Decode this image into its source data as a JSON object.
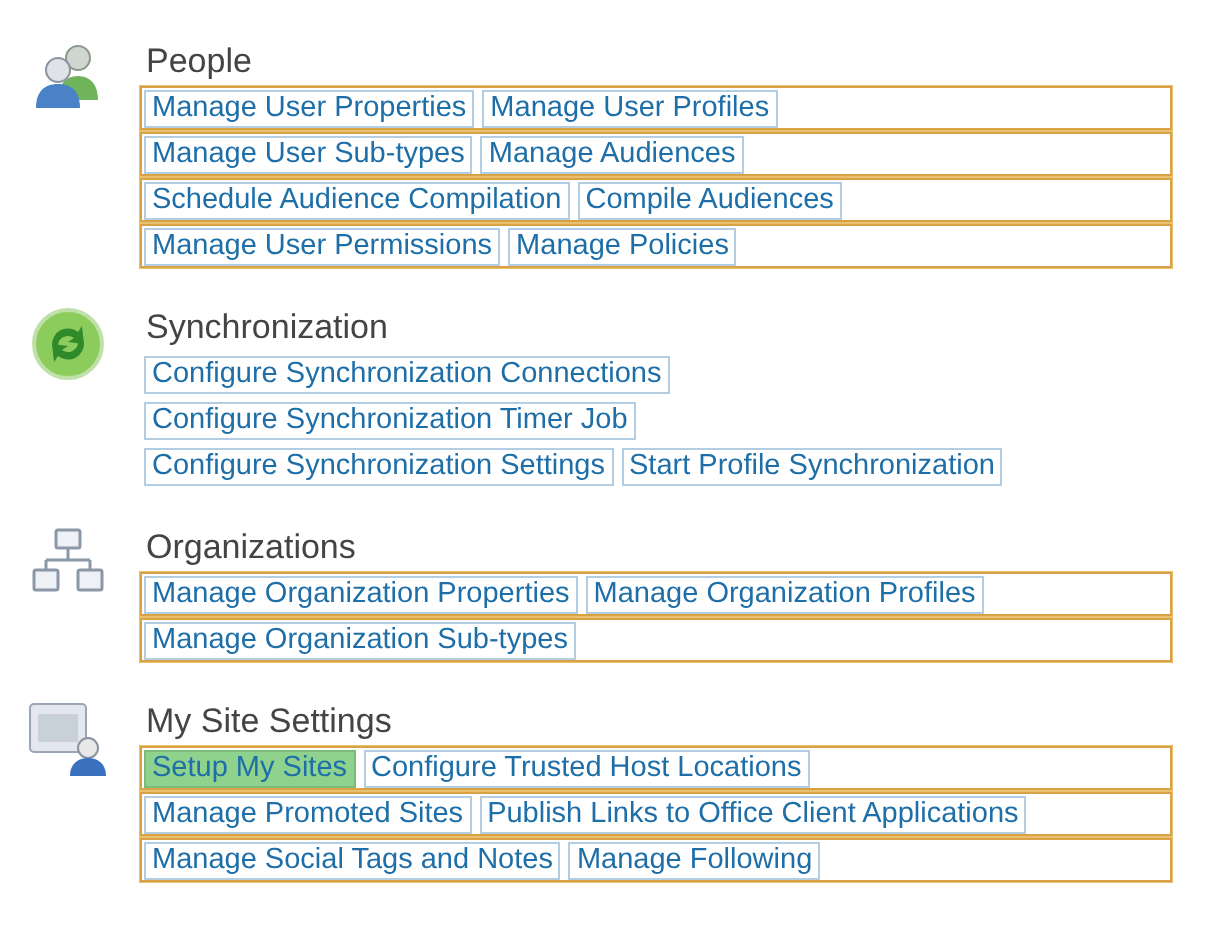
{
  "sections": [
    {
      "kind": "people",
      "title": "People",
      "rows": [
        {
          "highlighted": true,
          "links": [
            {
              "label": "Manage User Properties",
              "selected": false
            },
            {
              "label": "Manage User Profiles",
              "selected": false
            }
          ]
        },
        {
          "highlighted": true,
          "links": [
            {
              "label": "Manage User Sub-types",
              "selected": false
            },
            {
              "label": "Manage Audiences",
              "selected": false
            }
          ]
        },
        {
          "highlighted": true,
          "links": [
            {
              "label": "Schedule Audience Compilation",
              "selected": false
            },
            {
              "label": "Compile Audiences",
              "selected": false
            }
          ]
        },
        {
          "highlighted": true,
          "links": [
            {
              "label": "Manage User Permissions",
              "selected": false
            },
            {
              "label": "Manage Policies",
              "selected": false
            }
          ]
        }
      ]
    },
    {
      "kind": "sync",
      "title": "Synchronization",
      "rows": [
        {
          "highlighted": false,
          "links": [
            {
              "label": "Configure Synchronization Connections",
              "selected": false
            }
          ]
        },
        {
          "highlighted": false,
          "links": [
            {
              "label": "Configure Synchronization Timer Job",
              "selected": false
            }
          ]
        },
        {
          "highlighted": false,
          "links": [
            {
              "label": "Configure Synchronization Settings",
              "selected": false
            },
            {
              "label": "Start Profile Synchronization",
              "selected": false
            }
          ]
        }
      ]
    },
    {
      "kind": "org",
      "title": "Organizations",
      "rows": [
        {
          "highlighted": true,
          "links": [
            {
              "label": "Manage Organization Properties",
              "selected": false
            },
            {
              "label": "Manage Organization Profiles",
              "selected": false
            }
          ]
        },
        {
          "highlighted": true,
          "links": [
            {
              "label": "Manage Organization Sub-types",
              "selected": false
            }
          ]
        }
      ]
    },
    {
      "kind": "mysite",
      "title": "My Site Settings",
      "rows": [
        {
          "highlighted": true,
          "links": [
            {
              "label": "Setup My Sites",
              "selected": true
            },
            {
              "label": "Configure Trusted Host Locations",
              "selected": false
            }
          ]
        },
        {
          "highlighted": true,
          "links": [
            {
              "label": "Manage Promoted Sites",
              "selected": false
            },
            {
              "label": "Publish Links to Office Client Applications",
              "selected": false
            }
          ]
        },
        {
          "highlighted": true,
          "links": [
            {
              "label": "Manage Social Tags and Notes",
              "selected": false
            },
            {
              "label": "Manage Following",
              "selected": false
            }
          ]
        }
      ]
    }
  ]
}
